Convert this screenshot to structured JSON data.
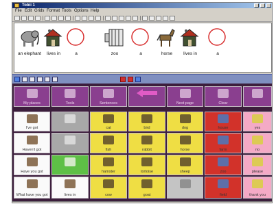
{
  "window": {
    "title": "Tobii 1"
  },
  "menu": [
    "File",
    "Edit",
    "Grids",
    "Format",
    "Tools",
    "Options",
    "Help"
  ],
  "sentence": [
    {
      "label": "an elephant",
      "icon": "elephant-icon"
    },
    {
      "label": "lives in",
      "icon": "house-icon"
    },
    {
      "label": "a",
      "icon": "circle-icon"
    },
    {
      "label": "zoo",
      "icon": "zoo-icon"
    },
    {
      "label": "a",
      "icon": "circle-icon"
    },
    {
      "label": "horse",
      "icon": "horse-icon"
    },
    {
      "label": "lives in",
      "icon": "house-icon"
    },
    {
      "label": "a",
      "icon": "circle-icon"
    }
  ],
  "grid": {
    "rows": [
      [
        {
          "label": "My places",
          "color": "top",
          "icon": "folder-icon"
        },
        {
          "label": "Tools",
          "color": "top",
          "icon": "tools-icon"
        },
        {
          "label": "Sentences",
          "color": "top",
          "icon": "book-icon"
        },
        {
          "label": "",
          "color": "top",
          "icon": "back-arrow-icon"
        },
        {
          "label": "Next page",
          "color": "top",
          "icon": "page-icon"
        },
        {
          "label": "Clear",
          "color": "top",
          "icon": "clear-icon"
        },
        {
          "label": "",
          "color": "top",
          "icon": "grid-icon"
        }
      ],
      [
        {
          "label": "I've got",
          "color": "white",
          "icon": "person-icon"
        },
        {
          "label": "",
          "color": "gray",
          "icon": "clock-icon"
        },
        {
          "label": "cat",
          "color": "yellow",
          "icon": "cat-icon"
        },
        {
          "label": "bird",
          "color": "yellow",
          "icon": "bird-icon"
        },
        {
          "label": "dog",
          "color": "yellow",
          "icon": "dog-icon"
        },
        {
          "label": "house",
          "color": "red",
          "icon": "red-house-icon"
        },
        {
          "label": "yes",
          "color": "pink",
          "icon": "yes-icon"
        }
      ],
      [
        {
          "label": "Haven't got",
          "color": "white",
          "icon": "no-person-icon"
        },
        {
          "label": "",
          "color": "gray",
          "icon": "bars-icon"
        },
        {
          "label": "fish",
          "color": "yellow",
          "icon": "fish-icon"
        },
        {
          "label": "rabbit",
          "color": "yellow",
          "icon": "rabbit-icon"
        },
        {
          "label": "horse",
          "color": "yellow",
          "icon": "horse-icon"
        },
        {
          "label": "farm",
          "color": "red",
          "icon": "farm-icon"
        },
        {
          "label": "no",
          "color": "pink",
          "icon": "no-icon"
        }
      ],
      [
        {
          "label": "Have you got",
          "color": "white",
          "icon": "question-person-icon"
        },
        {
          "label": "",
          "color": "green",
          "icon": "plus-icon"
        },
        {
          "label": "hamster",
          "color": "yellow",
          "icon": "hamster-icon"
        },
        {
          "label": "tortoise",
          "color": "yellow",
          "icon": "tortoise-icon"
        },
        {
          "label": "sheep",
          "color": "yellow",
          "icon": "sheep-icon"
        },
        {
          "label": "zoo",
          "color": "red",
          "icon": "zoo-icon"
        },
        {
          "label": "please",
          "color": "pink",
          "icon": "please-icon"
        }
      ],
      [
        {
          "label": "What have you got",
          "color": "white",
          "icon": "question-icon"
        },
        {
          "label": "lives in",
          "color": "white",
          "icon": "house-icon"
        },
        {
          "label": "cow",
          "color": "yellow",
          "icon": "cow-icon"
        },
        {
          "label": "goat",
          "color": "yellow",
          "icon": "goat-icon"
        },
        {
          "label": "",
          "color": "ltgray",
          "icon": "star-icon"
        },
        {
          "label": "field",
          "color": "red",
          "icon": "field-icon"
        },
        {
          "label": "thank you",
          "color": "pink",
          "icon": "thanks-icon"
        }
      ]
    ]
  }
}
